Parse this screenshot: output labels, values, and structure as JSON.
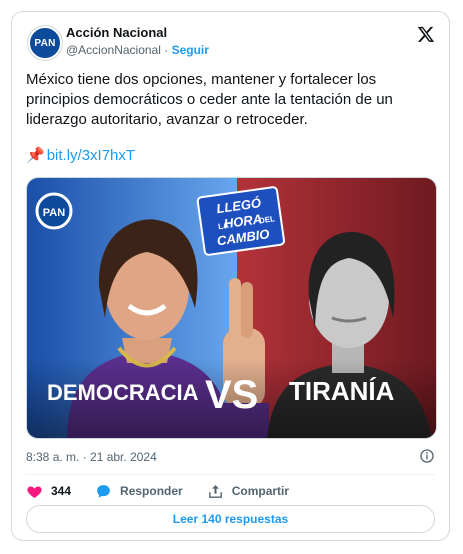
{
  "author": {
    "name": "Acción Nacional",
    "handle": "@AccionNacional",
    "separator": "·",
    "follow_label": "Seguir",
    "avatar_text": "PAN"
  },
  "tweet": {
    "text": "México tiene dos opciones, mantener y fortalecer los principios democráticos o ceder ante la tentación de un liderazgo autoritario, avanzar o retroceder.",
    "link_text": "bit.ly/3xI7hxT",
    "pin_icon": "📌"
  },
  "media": {
    "logo_text": "PAN",
    "badge_lines": [
      "LLEGÓ",
      "LA",
      "HORA",
      "DEL",
      "CAMBIO"
    ],
    "left_word": "DEMOCRACIA",
    "vs_word": "VS",
    "right_word": "TIRANÍA",
    "left_color": "#1f5fbf",
    "right_color": "#b4323a"
  },
  "timestamp": "8:38 a. m. · 21 abr. 2024",
  "actions": {
    "like_count": "344",
    "reply_label": "Responder",
    "share_label": "Compartir"
  },
  "read_replies_label": "Leer 140 respuestas",
  "colors": {
    "accent": "#1d9bf0",
    "like": "#f91880",
    "muted": "#536471"
  }
}
